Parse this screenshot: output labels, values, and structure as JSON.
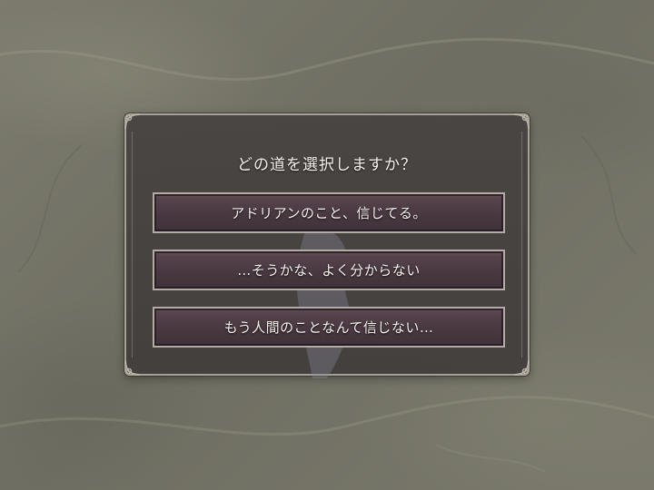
{
  "dialog": {
    "prompt": "どの道を選択しますか？",
    "choices": [
      {
        "label": "アドリアンのこと、信じてる。"
      },
      {
        "label": "…そうかな、よく分からない"
      },
      {
        "label": "もう人間のことなんて信じない…"
      }
    ]
  },
  "colors": {
    "background": "#757468",
    "dialog_panel": "#45413f",
    "dialog_border": "#a8a197",
    "choice_fill": "#4a3a42",
    "choice_border": "#b4aca2",
    "text": "#f4f1ec"
  }
}
